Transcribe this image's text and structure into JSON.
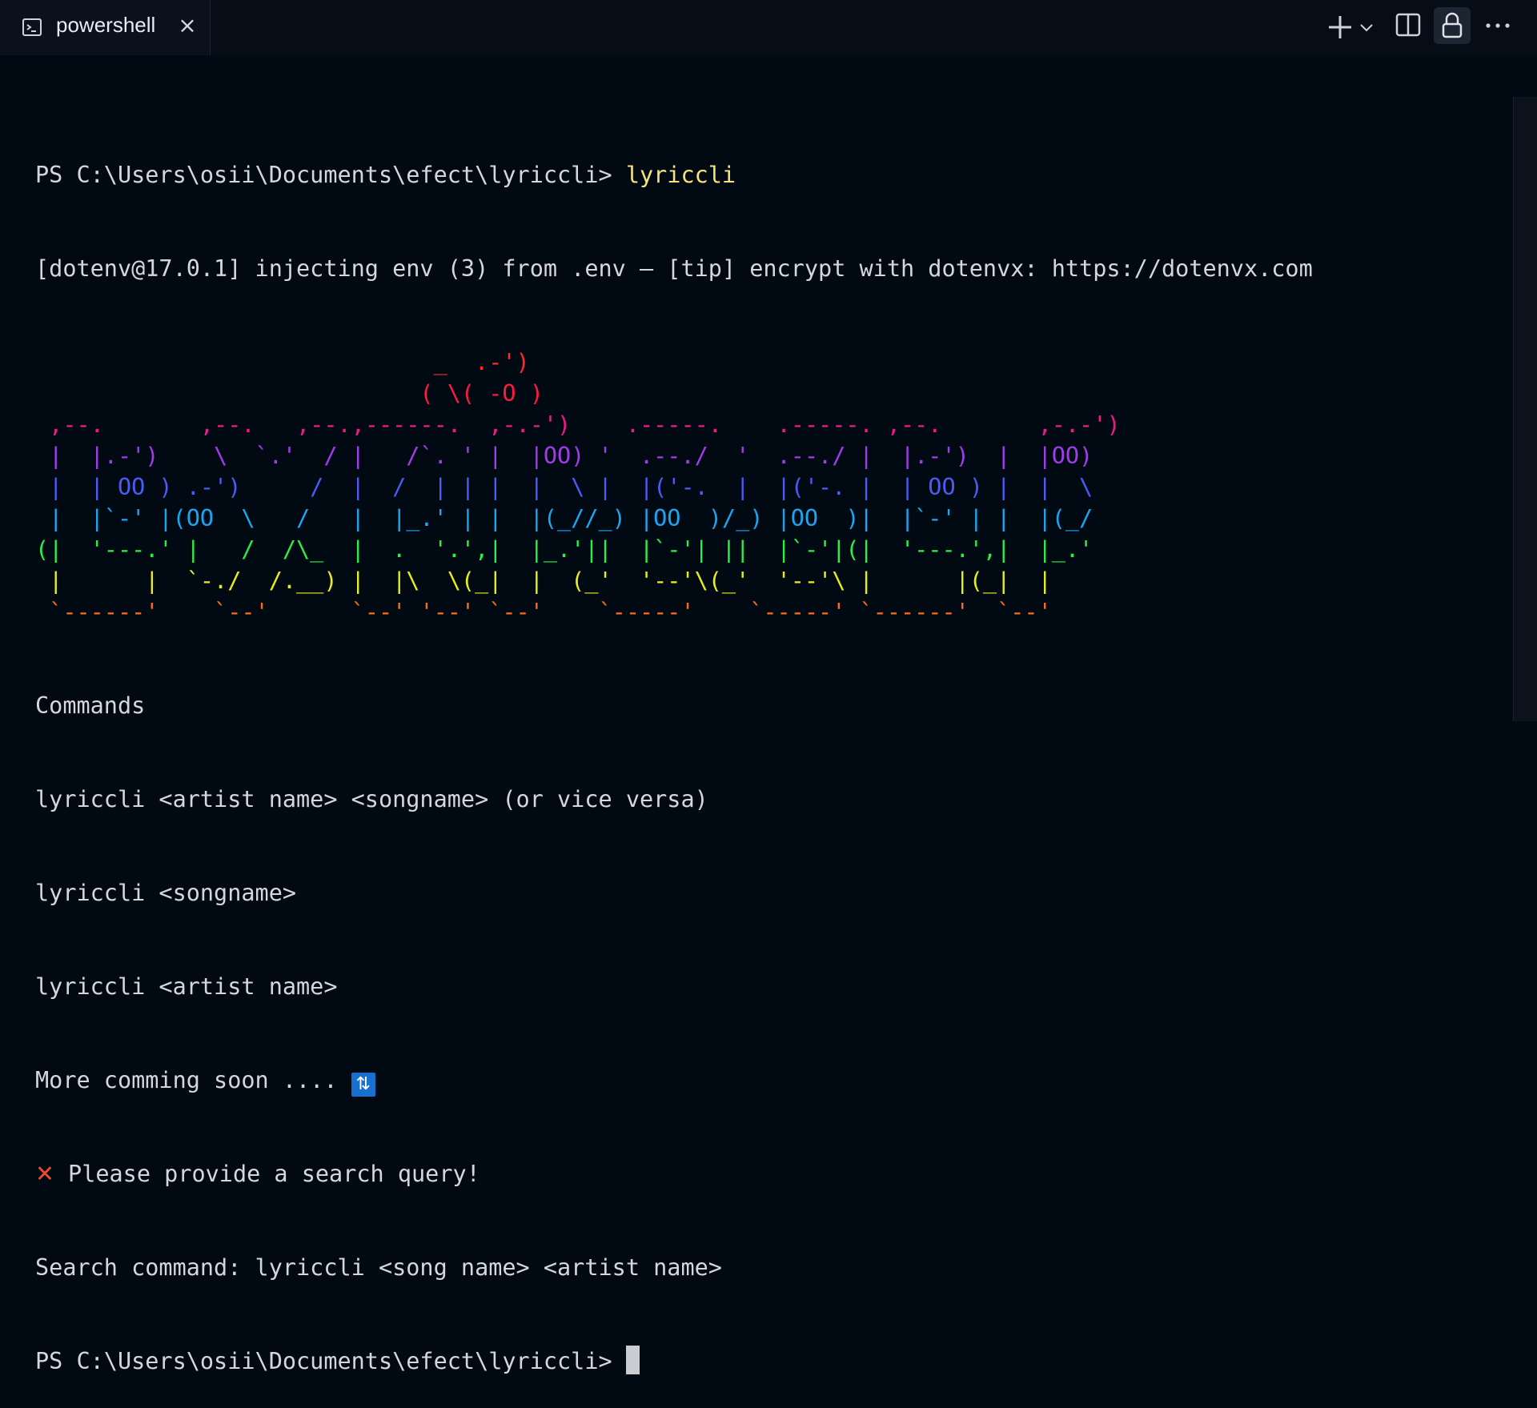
{
  "tab": {
    "label": "powershell",
    "icon": "terminal-icon",
    "close_icon": "×"
  },
  "toolbar": {
    "icons": [
      "plus-icon",
      "chevron-down-icon",
      "split-icon",
      "lock-icon",
      "more-icon"
    ]
  },
  "terminal": {
    "prompt": "PS C:\\Users\\osii\\Documents\\efect\\lyriccli> ",
    "command": "lyriccli",
    "dotenv": "[dotenv@17.0.1] injecting env (3) from .env – [tip] encrypt with dotenvx: https://dotenvx.com",
    "ascii_art": [
      {
        "text": "                             _  .-')",
        "color": "#ff2a24"
      },
      {
        "text": "                            ( \\( -O )",
        "color": "#ff1a3f"
      },
      {
        "text": " ,--.       ,--.   ,--.,------.  ,-.-')    .-----.    .-----. ,--.       ,-.-')",
        "color": "#f0198c"
      },
      {
        "text": " |  |.-')    \\  `.'  / |   /`. ' |  |OO) '  .--./  '  .--./ |  |.-')  |  |OO)",
        "color": "#a23bea"
      },
      {
        "text": " |  | OO ) .-')     /  |  /  | | |  |  \\ |  |('-.  |  |('-. |  | OO ) |  |  \\",
        "color": "#4a5cf3"
      },
      {
        "text": " |  |`-' |(OO  \\   /   |  |_.' | |  |(_//_) |OO  )/_) |OO  )|  |`-' | |  |(_/",
        "color": "#1aa6f0"
      },
      {
        "text": "(|  '---.' |   /  /\\_  |  .  '.',|  |_.'||  |`-'| ||  |`-'|(|  '---.',|  |_.'",
        "color": "#2bef45"
      },
      {
        "text": " |      |  `-./  /.__) |  |\\  \\(_|  |  (_'  '--'\\(_'  '--'\\ |      |(_|  |",
        "color": "#e6ee1a"
      },
      {
        "text": " `------'    `--'      `--' '--' `--'    `-----'    `-----' `------'  `--'",
        "color": "#ff6a1a"
      }
    ],
    "commands_header": "Commands",
    "usage_lines": [
      "lyriccli <artist name> <songname> (or vice versa)",
      "lyriccli <songname>",
      "lyriccli <artist name>"
    ],
    "more_text": "More comming soon .... ",
    "more_badge": "⇅",
    "error_icon": "✕",
    "error_text": " Please provide a search query!",
    "search_hint": "Search command: lyriccli <song name> <artist name>"
  }
}
